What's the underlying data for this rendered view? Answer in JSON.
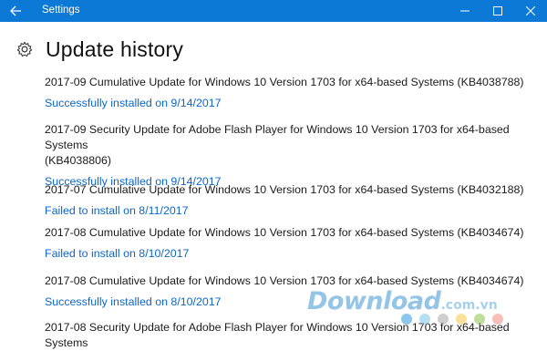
{
  "window": {
    "title": "Settings",
    "accent": "#0c79d6"
  },
  "page": {
    "title": "Update history"
  },
  "updates": [
    {
      "name": "2017-09 Cumulative Update for Windows 10 Version 1703 for x64-based Systems (KB4038788)",
      "status": "Successfully installed on 9/14/2017"
    },
    {
      "name_line1": "2017-09 Security Update for Adobe Flash Player for Windows 10 Version 1703 for x64-based Systems",
      "name_line2": "(KB4038806)",
      "status": "Successfully installed on 9/14/2017"
    },
    {
      "name": "2017-07 Cumulative Update for Windows 10 Version 1703 for x64-based Systems (KB4032188)",
      "status": "Failed to install on 8/11/2017"
    },
    {
      "name": "2017-08 Cumulative Update for Windows 10 Version 1703 for x64-based Systems (KB4034674)",
      "status": "Failed to install on 8/10/2017"
    },
    {
      "name": "2017-08 Cumulative Update for Windows 10 Version 1703 for x64-based Systems (KB4034674)",
      "status": "Successfully installed on 8/10/2017"
    },
    {
      "name_line1": "2017-08 Security Update for Adobe Flash Player for Windows 10 Version 1703 for x64-based Systems"
    }
  ],
  "watermark": {
    "brand": "Download",
    "suffix": ".com.vn"
  },
  "watermark_dot_colors": [
    "#2e9be0",
    "#7ac5e8",
    "#a7a7a7",
    "#f4c84a",
    "#8bc34a",
    "#f28b82"
  ],
  "icons": {
    "back": "back-arrow-icon",
    "settings": "gear-icon"
  }
}
